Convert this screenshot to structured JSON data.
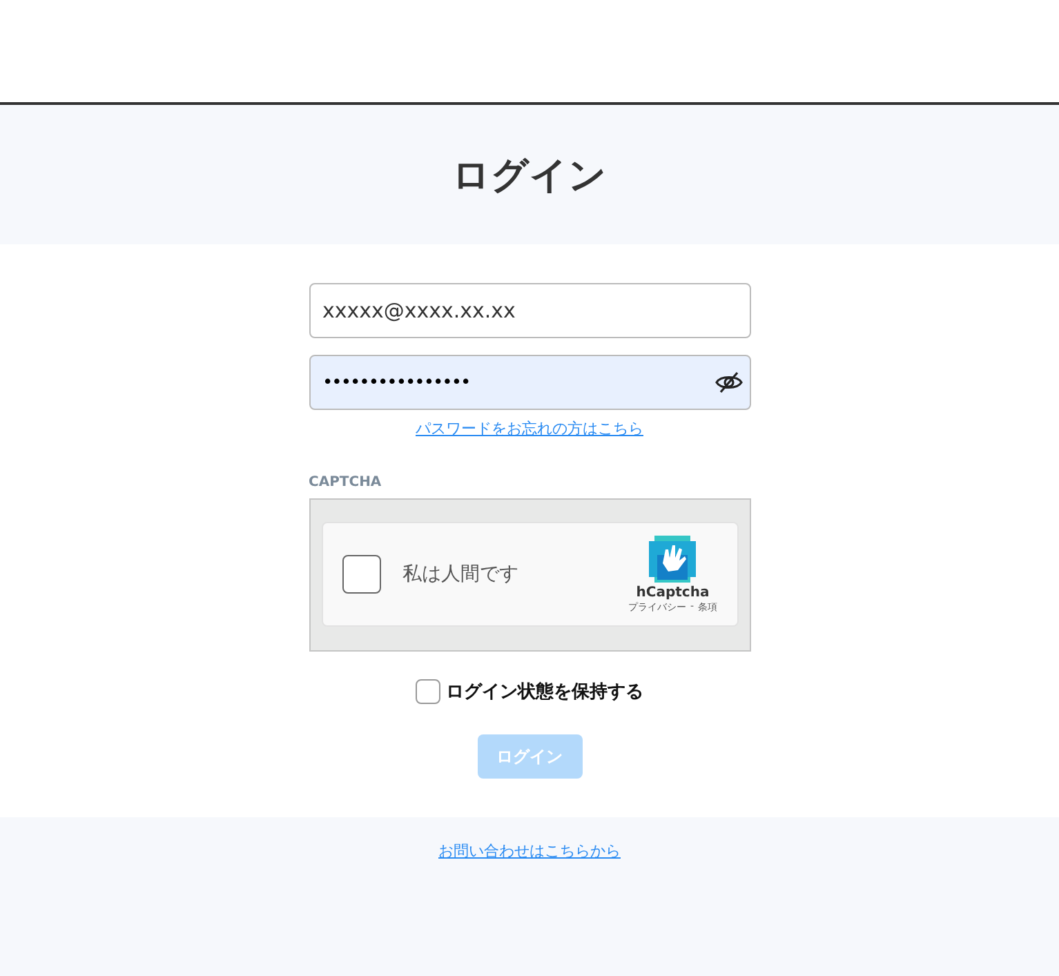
{
  "title": "ログイン",
  "email": {
    "value": "xxxxx@xxxx.xx.xx"
  },
  "password": {
    "value": "••••••••••••••••"
  },
  "forgot_link": "パスワードをお忘れの方はこちら",
  "captcha": {
    "label": "CAPTCHA",
    "checkbox_label": "私は人間です",
    "checked": false,
    "brand": "hCaptcha",
    "privacy": "プライバシー",
    "separator": "-",
    "terms": "条項"
  },
  "remember": {
    "label": "ログイン状態を保持する",
    "checked": false
  },
  "login_button": {
    "label": "ログイン",
    "disabled": true
  },
  "contact_link": "お問い合わせはこちらから"
}
